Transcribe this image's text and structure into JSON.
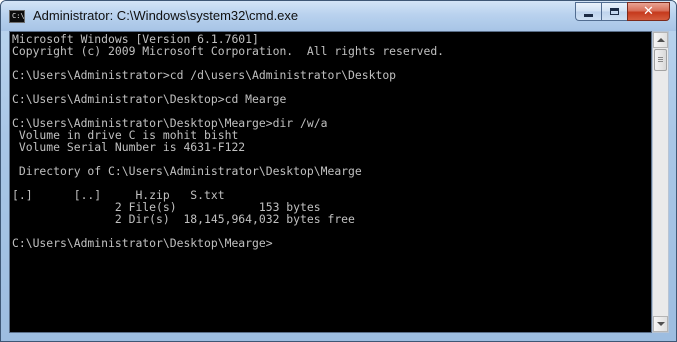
{
  "window": {
    "title": "Administrator: C:\\Windows\\system32\\cmd.exe",
    "icon": "cmd-console-icon",
    "icon_text": "C:\\"
  },
  "caption_buttons": {
    "minimize_icon": "minimize-icon",
    "maximize_icon": "maximize-icon",
    "close_icon": "close-icon",
    "close_label": "✕"
  },
  "console": {
    "background": "#000000",
    "foreground": "#c0c0c0",
    "lines": [
      "Microsoft Windows [Version 6.1.7601]",
      "Copyright (c) 2009 Microsoft Corporation.  All rights reserved.",
      "",
      "C:\\Users\\Administrator>cd /d\\users\\Administrator\\Desktop",
      "",
      "C:\\Users\\Administrator\\Desktop>cd Mearge",
      "",
      "C:\\Users\\Administrator\\Desktop\\Mearge>dir /w/a",
      " Volume in drive C is mohit bisht",
      " Volume Serial Number is 4631-F122",
      "",
      " Directory of C:\\Users\\Administrator\\Desktop\\Mearge",
      "",
      "[.]      [..]     H.zip   S.txt",
      "               2 File(s)            153 bytes",
      "               2 Dir(s)  18,145,964,032 bytes free",
      "",
      "C:\\Users\\Administrator\\Desktop\\Mearge>"
    ]
  },
  "scrollbar": {
    "up_icon": "scroll-up-arrow-icon",
    "down_icon": "scroll-down-arrow-icon"
  }
}
